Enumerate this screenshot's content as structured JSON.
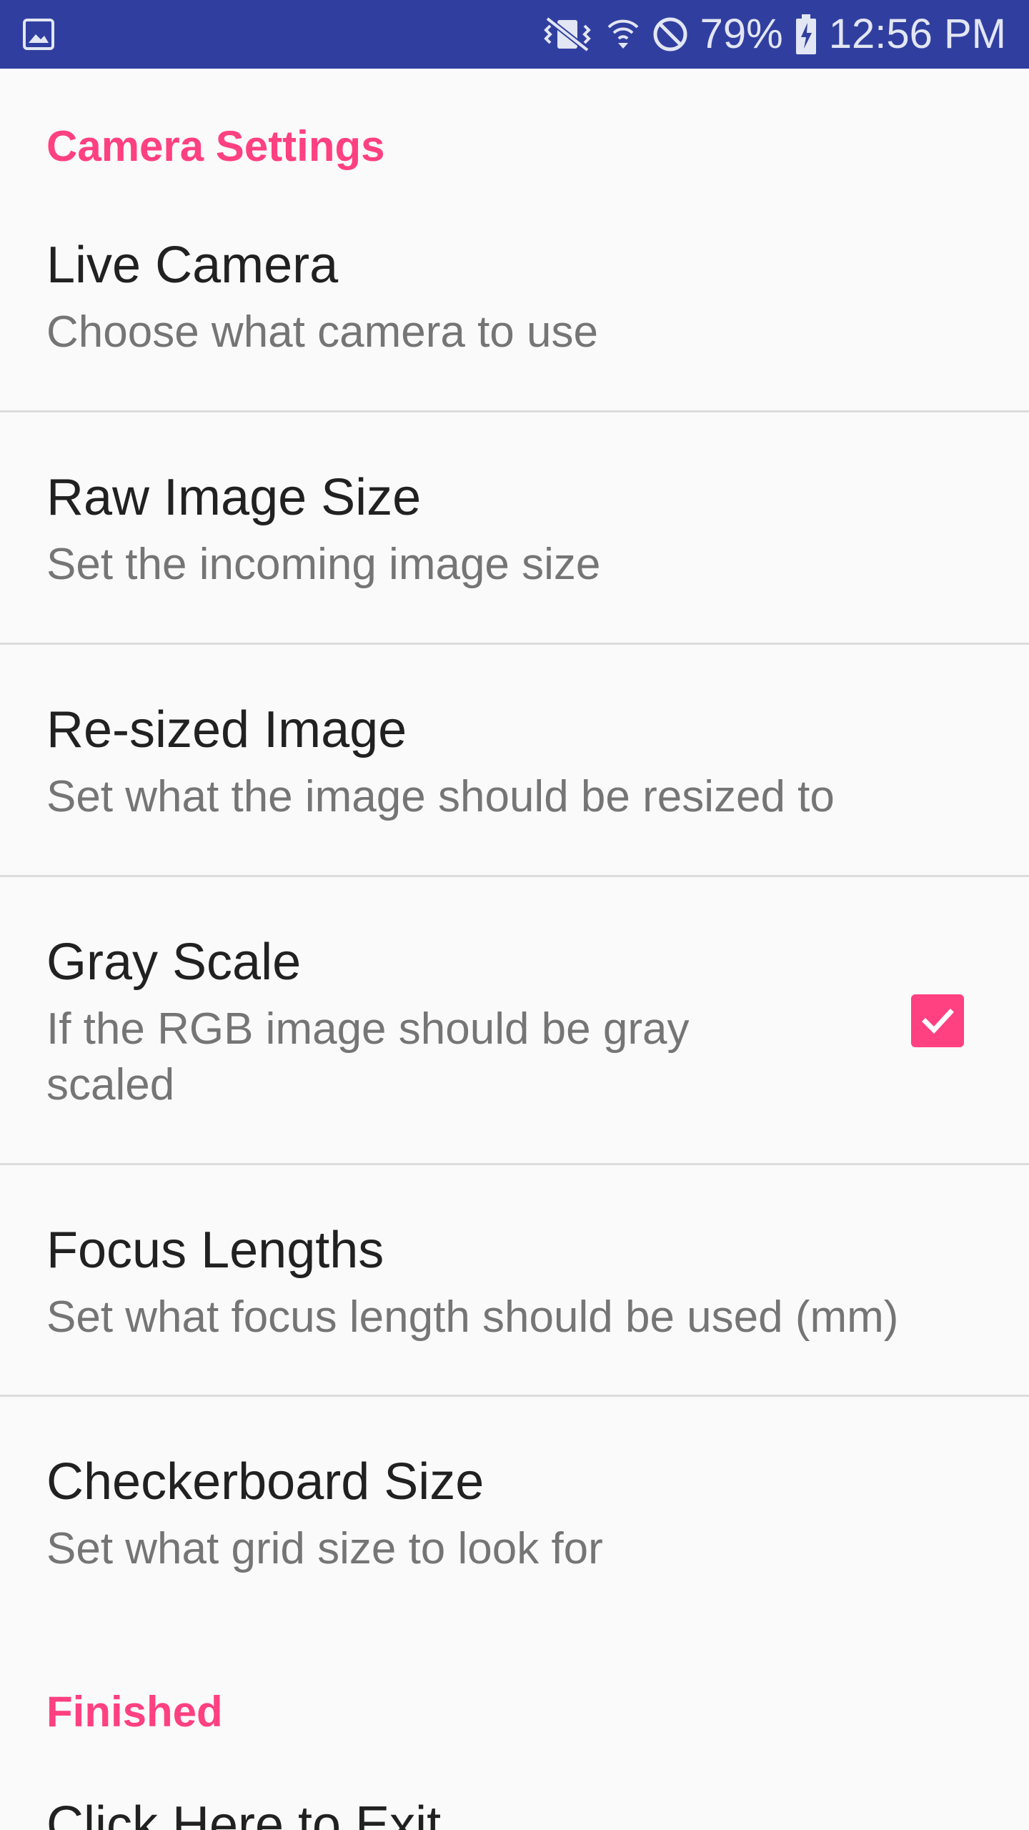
{
  "status_bar": {
    "battery": "79%",
    "time": "12:56 PM"
  },
  "categories": {
    "camera_settings": "Camera Settings",
    "finished": "Finished"
  },
  "prefs": [
    {
      "title": "Live Camera",
      "summary": "Choose what camera to use"
    },
    {
      "title": "Raw Image Size",
      "summary": "Set the incoming image size"
    },
    {
      "title": "Re-sized Image",
      "summary": "Set what the image should be resized to"
    },
    {
      "title": "Gray Scale",
      "summary": "If the RGB image should be gray scaled",
      "checked": true
    },
    {
      "title": "Focus Lengths",
      "summary": "Set what focus length should be used (mm)"
    },
    {
      "title": "Checkerboard Size",
      "summary": "Set what grid size to look for"
    },
    {
      "title": "Click Here to Exit"
    }
  ],
  "colors": {
    "status_bar": "#303f9f",
    "accent": "#ff4081",
    "background": "#fafafa"
  }
}
